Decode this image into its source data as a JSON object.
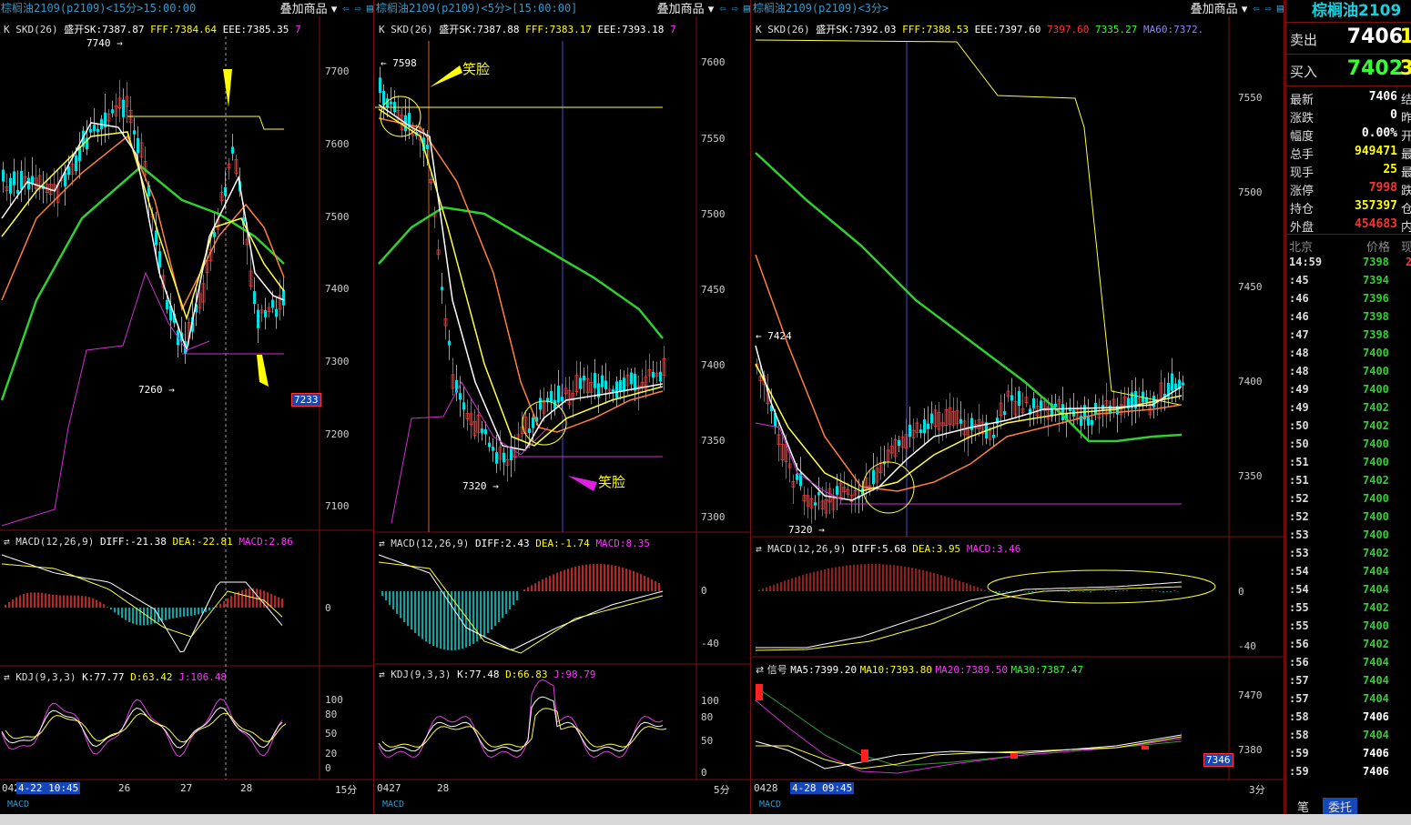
{
  "panels": [
    {
      "title": "棕榈油2109(p2109)<15分>15:00:00",
      "overlay": "叠加商品",
      "main_indicator": {
        "name": "K SKD(26)",
        "sk": "盛开SK:7387.87",
        "fff": "FFF:7384.64",
        "eee": "EEE:7385.35",
        "extra": "7"
      },
      "price_axis": [
        "7700",
        "7600",
        "7500",
        "7400",
        "7300",
        "7200",
        "7100"
      ],
      "price_tag": "7233",
      "annotations": {
        "high": "7740",
        "low": "7260"
      },
      "macd": {
        "label": "MACD(12,26,9)",
        "diff": "DIFF:-21.38",
        "dea": "DEA:-22.81",
        "macd": "MACD:2.86",
        "axis": [
          "0"
        ]
      },
      "kdj": {
        "label": "KDJ(9,3,3)",
        "k": "K:77.77",
        "d": "D:63.42",
        "j": "J:106.48",
        "axis": [
          "100",
          "80",
          "50",
          "20",
          "0"
        ]
      },
      "dates": {
        "start": "042",
        "cursor": "4-22 10:45",
        "d1": "26",
        "d2": "27",
        "d3": "28",
        "period": "15分"
      },
      "footer": "MACD"
    },
    {
      "title": "棕榈油2109(p2109)<5分>[15:00:00]",
      "overlay": "叠加商品",
      "main_indicator": {
        "name": "K SKD(26)",
        "sk": "盛开SK:7387.88",
        "fff": "FFF:7383.17",
        "eee": "EEE:7393.18",
        "extra": "7"
      },
      "price_axis": [
        "7600",
        "7550",
        "7500",
        "7450",
        "7400",
        "7350",
        "7300"
      ],
      "annotations": {
        "high": "7598",
        "low": "7320",
        "smile1": "笑脸",
        "smile2": "笑脸"
      },
      "macd": {
        "label": "MACD(12,26,9)",
        "diff": "DIFF:2.43",
        "dea": "DEA:-1.74",
        "macd": "MACD:8.35",
        "axis": [
          "0",
          "-40"
        ]
      },
      "kdj": {
        "label": "KDJ(9,3,3)",
        "k": "K:77.48",
        "d": "D:66.83",
        "j": "J:98.79",
        "axis": [
          "100",
          "80",
          "50",
          "0"
        ]
      },
      "dates": {
        "start": "0427",
        "d1": "28",
        "period": "5分"
      },
      "footer": "MACD"
    },
    {
      "title": "棕榈油2109(p2109)<3分>",
      "overlay": "叠加商品",
      "main_indicator": {
        "name": "K SKD(26)",
        "sk": "盛开SK:7392.03",
        "fff": "FFF:7388.53",
        "eee": "EEE:7397.60",
        "v1": "7397.60",
        "v2": "7335.27",
        "ma60": "MA60:7372."
      },
      "price_axis": [
        "7550",
        "7500",
        "7450",
        "7400",
        "7350"
      ],
      "annotations": {
        "high": "7424",
        "low": "7320"
      },
      "macd": {
        "label": "MACD(12,26,9)",
        "diff": "DIFF:5.68",
        "dea": "DEA:3.95",
        "macd": "MACD:3.46",
        "axis": [
          "0",
          "-40"
        ]
      },
      "signal": {
        "label": "信号",
        "ma5": "MA5:7399.20",
        "ma10": "MA10:7393.80",
        "ma20": "MA20:7389.50",
        "ma30": "MA30:7387.47",
        "axis": [
          "7470",
          "7380"
        ],
        "tag": "7346"
      },
      "dates": {
        "start": "0428",
        "cursor": "4-28 09:45",
        "period": "3分"
      },
      "footer": "MACD"
    }
  ],
  "quote": {
    "title": "棕榈油2109",
    "sell": {
      "label": "卖出",
      "price": "7406",
      "extra": "1"
    },
    "buy": {
      "label": "买入",
      "price": "7402",
      "extra": "3"
    },
    "stats": [
      {
        "label": "最新",
        "value": "7406",
        "color": "#ffffff",
        "x": "结"
      },
      {
        "label": "涨跌",
        "value": "0",
        "color": "#ffffff",
        "x": "昨"
      },
      {
        "label": "幅度",
        "value": "0.00%",
        "color": "#ffffff",
        "x": "开"
      },
      {
        "label": "总手",
        "value": "949471",
        "color": "#ffff00",
        "x": "最"
      },
      {
        "label": "现手",
        "value": "25",
        "color": "#ffff00",
        "x": "最"
      },
      {
        "label": "涨停",
        "value": "7998",
        "color": "#ff3030",
        "x": "跌"
      },
      {
        "label": "持仓",
        "value": "357397",
        "color": "#ffff00",
        "x": "仓"
      },
      {
        "label": "外盘",
        "value": "454683",
        "color": "#ff3030",
        "x": "内"
      }
    ],
    "tick_header": {
      "time": "北京",
      "price": "价格",
      "vol": "现"
    },
    "ticks": [
      {
        "time": "14:59",
        "price": "7398",
        "extra": "2"
      },
      {
        "time": ":45",
        "price": "7394"
      },
      {
        "time": ":46",
        "price": "7396"
      },
      {
        "time": ":46",
        "price": "7398"
      },
      {
        "time": ":47",
        "price": "7398"
      },
      {
        "time": ":48",
        "price": "7400"
      },
      {
        "time": ":48",
        "price": "7400"
      },
      {
        "time": ":49",
        "price": "7400"
      },
      {
        "time": ":49",
        "price": "7402"
      },
      {
        "time": ":50",
        "price": "7402"
      },
      {
        "time": ":50",
        "price": "7400"
      },
      {
        "time": ":51",
        "price": "7400"
      },
      {
        "time": ":51",
        "price": "7402"
      },
      {
        "time": ":52",
        "price": "7400"
      },
      {
        "time": ":52",
        "price": "7400"
      },
      {
        "time": ":53",
        "price": "7400"
      },
      {
        "time": ":53",
        "price": "7402"
      },
      {
        "time": ":54",
        "price": "7404"
      },
      {
        "time": ":54",
        "price": "7404"
      },
      {
        "time": ":55",
        "price": "7402"
      },
      {
        "time": ":55",
        "price": "7400"
      },
      {
        "time": ":56",
        "price": "7402"
      },
      {
        "time": ":56",
        "price": "7404"
      },
      {
        "time": ":57",
        "price": "7404"
      },
      {
        "time": ":57",
        "price": "7404"
      },
      {
        "time": ":58",
        "price": "7406"
      },
      {
        "time": ":58",
        "price": "7404"
      },
      {
        "time": ":59",
        "price": "7406"
      },
      {
        "time": ":59",
        "price": "7406"
      }
    ],
    "tabs": [
      "笔",
      "委托"
    ]
  },
  "colors": {
    "up": "#ff3030",
    "down": "#00e0e0",
    "grid": "#7a1010",
    "ma_green": "#30d030",
    "yellow": "#ffff40",
    "orange": "#ff8040",
    "white": "#ffffff",
    "magenta": "#e040e0"
  }
}
